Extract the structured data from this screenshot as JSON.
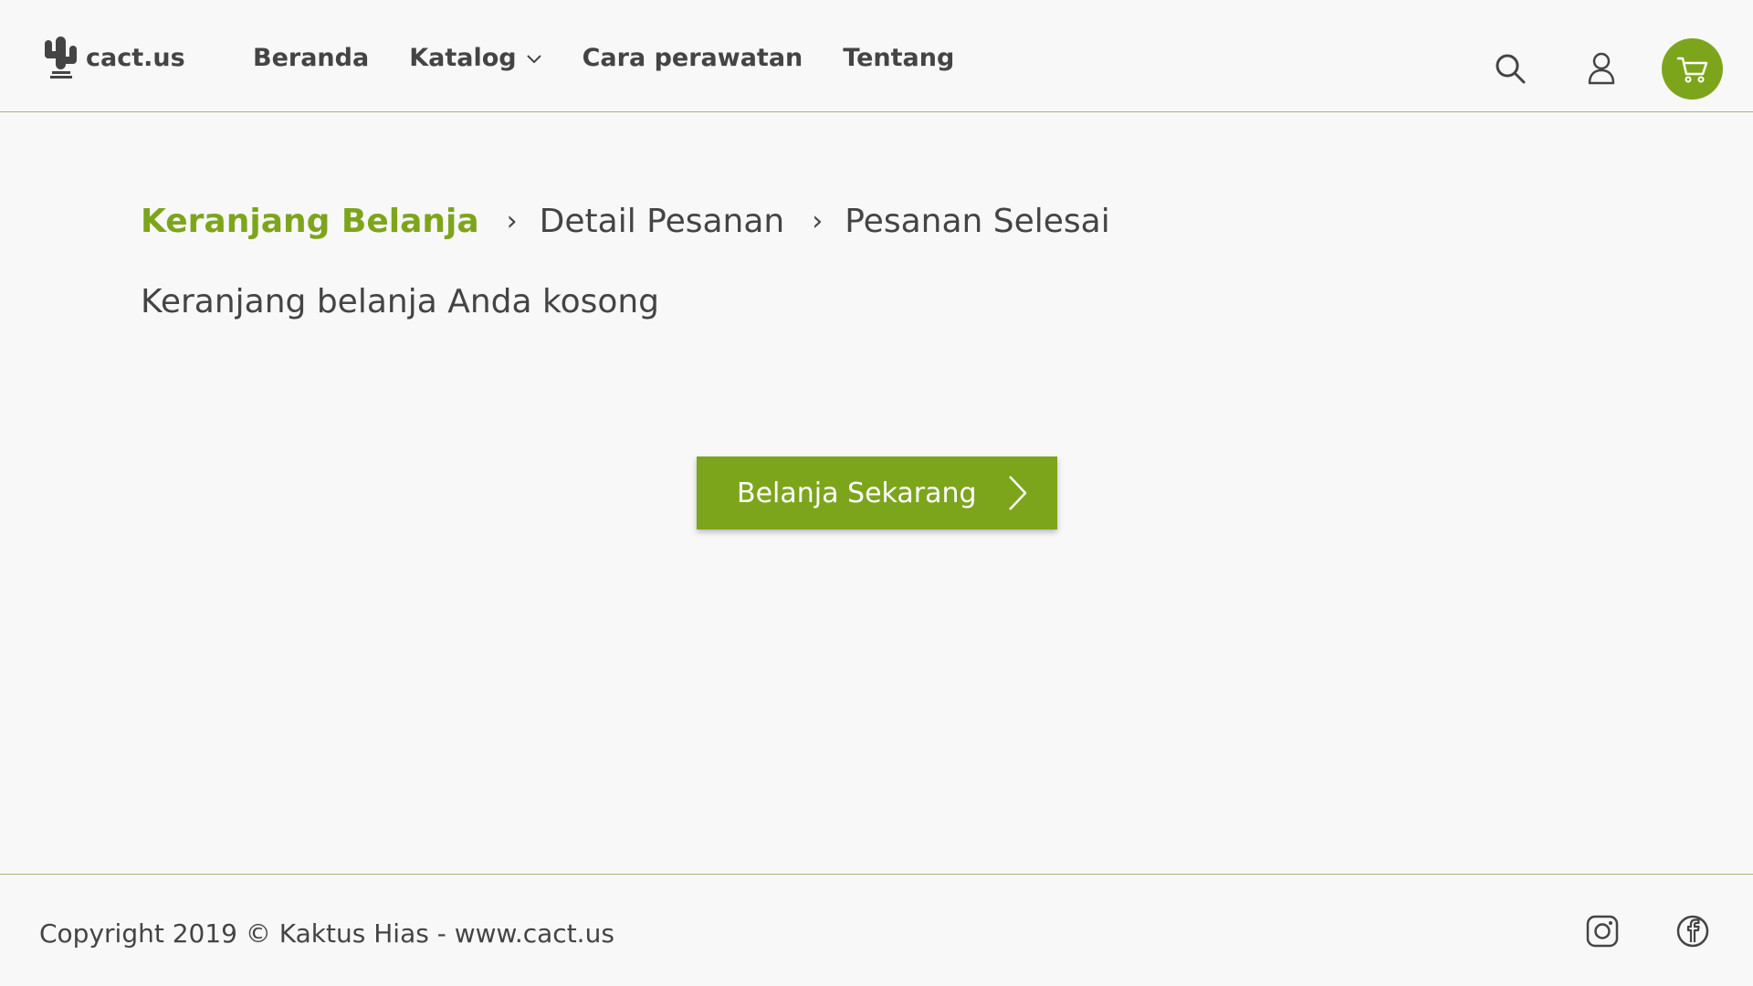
{
  "header": {
    "logo_text": "cact.us",
    "nav": [
      {
        "label": "Beranda"
      },
      {
        "label": "Katalog"
      },
      {
        "label": "Cara perawatan"
      },
      {
        "label": "Tentang"
      }
    ],
    "icons": [
      "search-icon",
      "user-icon",
      "cart-icon"
    ]
  },
  "checkout_steps": [
    {
      "label": "Keranjang Belanja"
    },
    {
      "label": "Detail Pesanan"
    },
    {
      "label": "Pesanan Selesai"
    }
  ],
  "step_separator": "›",
  "main": {
    "empty_message": "Keranjang belanja Anda kosong",
    "shop_button_label": "Belanja Sekarang"
  },
  "footer": {
    "copyright": "Copyright 2019 © Kaktus Hias - www.cact.us",
    "social_icons": [
      "instagram-icon",
      "facebook-icon"
    ]
  },
  "colors": {
    "accent": "#7da51c",
    "text": "#444444",
    "background": "#f8f8f8",
    "divider": "#a4b878"
  }
}
